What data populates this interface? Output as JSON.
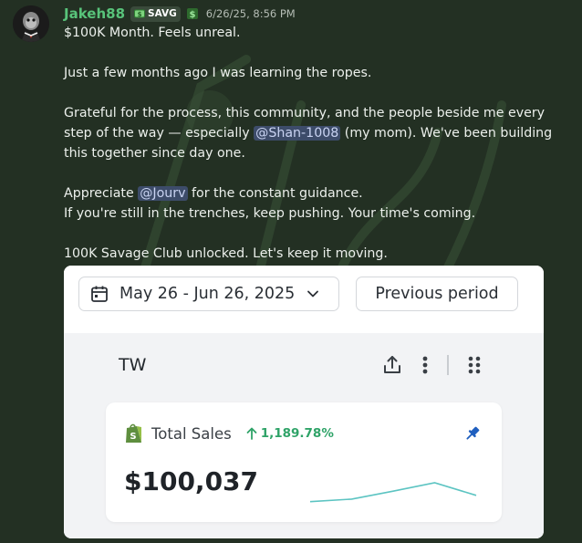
{
  "message": {
    "username": "Jakeh88",
    "tag_label": "SAVG",
    "timestamp": "6/26/25, 8:56 PM",
    "lines": {
      "l1": "$100K Month. Feels unreal.",
      "l2": "Just a few months ago I was learning the ropes.",
      "l3": "Grateful for the process, this community, and the people beside me every step of the way — especially",
      "mention1": "@Shan-1008",
      "l3_end": "(my mom). We've been building this together since day one.",
      "l4_start": "Appreciate",
      "mention2": "@Jourv",
      "l4_end": "for the constant guidance.",
      "l5": "If you're still in the trenches, keep pushing. Your time's coming.",
      "l6": "100K Savage Club unlocked. Let's keep it moving."
    }
  },
  "screenshot": {
    "date_range": "May 26 - Jun 26, 2025",
    "compare_button": "Previous period",
    "store_label": "TW",
    "card": {
      "title": "Total Sales",
      "change": "1,189.78%",
      "value": "$100,037",
      "sparkline": [
        0.1,
        0.22,
        0.6,
        1.0,
        0.4
      ]
    }
  },
  "colors": {
    "username": "#58c37a",
    "mention_bg": "#3d4c6a",
    "positive": "#2fa368",
    "spark_line": "#5cc4c2"
  }
}
